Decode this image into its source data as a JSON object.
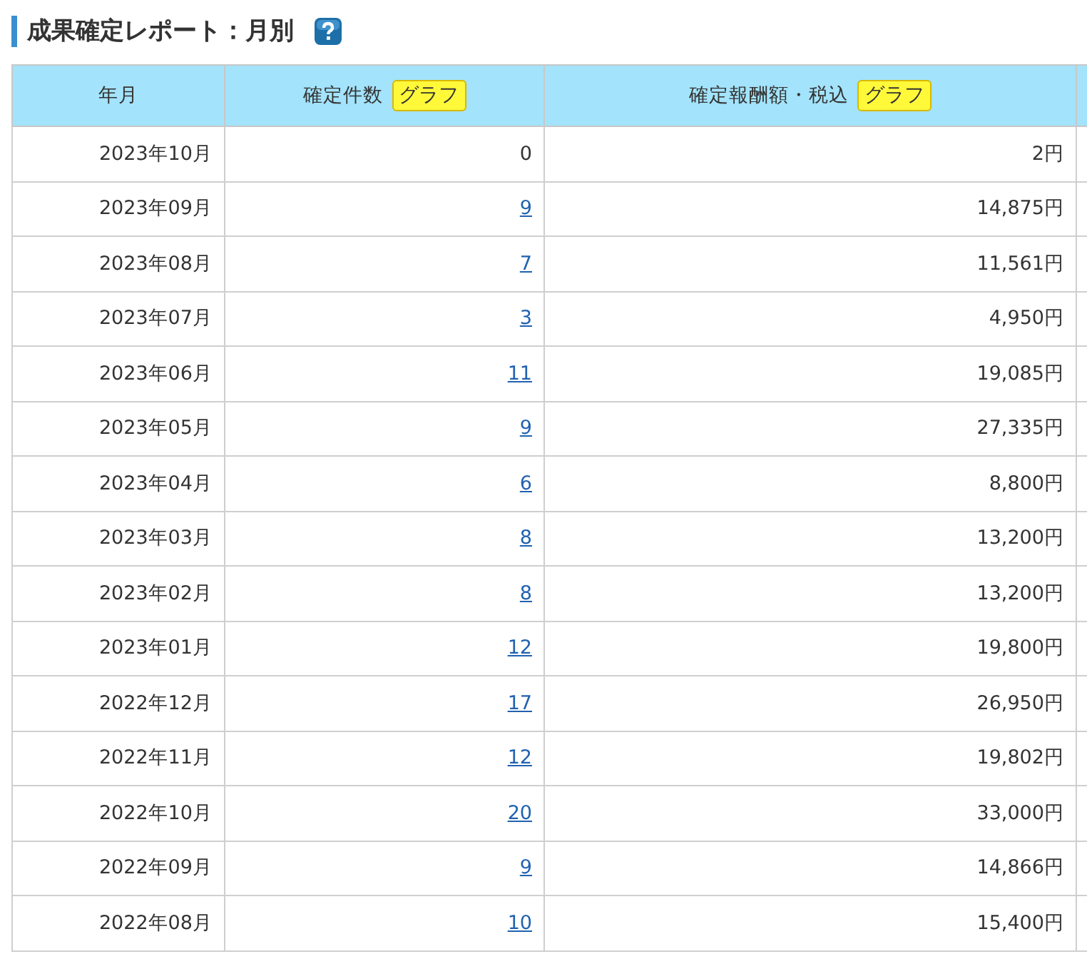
{
  "title": "成果確定レポート：月別",
  "columns": [
    {
      "label": "年月"
    },
    {
      "label": "確定件数",
      "button": "グラフ"
    },
    {
      "label": "確定報酬額・税込",
      "button": "グラフ"
    }
  ],
  "rows": [
    {
      "month": "2023年10月",
      "count": {
        "text": "0",
        "kind": "plain"
      },
      "amount": "2円"
    },
    {
      "month": "2023年09月",
      "count": {
        "text": "9",
        "kind": "link"
      },
      "amount": "14,875円"
    },
    {
      "month": "2023年08月",
      "count": {
        "text": "7",
        "kind": "link"
      },
      "amount": "11,561円"
    },
    {
      "month": "2023年07月",
      "count": {
        "text": "3",
        "kind": "link"
      },
      "amount": "4,950円"
    },
    {
      "month": "2023年06月",
      "count": {
        "text": "11",
        "kind": "link"
      },
      "amount": "19,085円"
    },
    {
      "month": "2023年05月",
      "count": {
        "text": "9",
        "kind": "link"
      },
      "amount": "27,335円"
    },
    {
      "month": "2023年04月",
      "count": {
        "text": "6",
        "kind": "link"
      },
      "amount": "8,800円"
    },
    {
      "month": "2023年03月",
      "count": {
        "text": "8",
        "kind": "link"
      },
      "amount": "13,200円"
    },
    {
      "month": "2023年02月",
      "count": {
        "text": "8",
        "kind": "link"
      },
      "amount": "13,200円"
    },
    {
      "month": "2023年01月",
      "count": {
        "text": "12",
        "kind": "link"
      },
      "amount": "19,800円"
    },
    {
      "month": "2022年12月",
      "count": {
        "text": "17",
        "kind": "link"
      },
      "amount": "26,950円"
    },
    {
      "month": "2022年11月",
      "count": {
        "text": "12",
        "kind": "link"
      },
      "amount": "19,802円"
    },
    {
      "month": "2022年10月",
      "count": {
        "text": "20",
        "kind": "link"
      },
      "amount": "33,000円"
    },
    {
      "month": "2022年09月",
      "count": {
        "text": "9",
        "kind": "link"
      },
      "amount": "14,866円"
    },
    {
      "month": "2022年08月",
      "count": {
        "text": "10",
        "kind": "link"
      },
      "amount": "15,400円"
    }
  ]
}
